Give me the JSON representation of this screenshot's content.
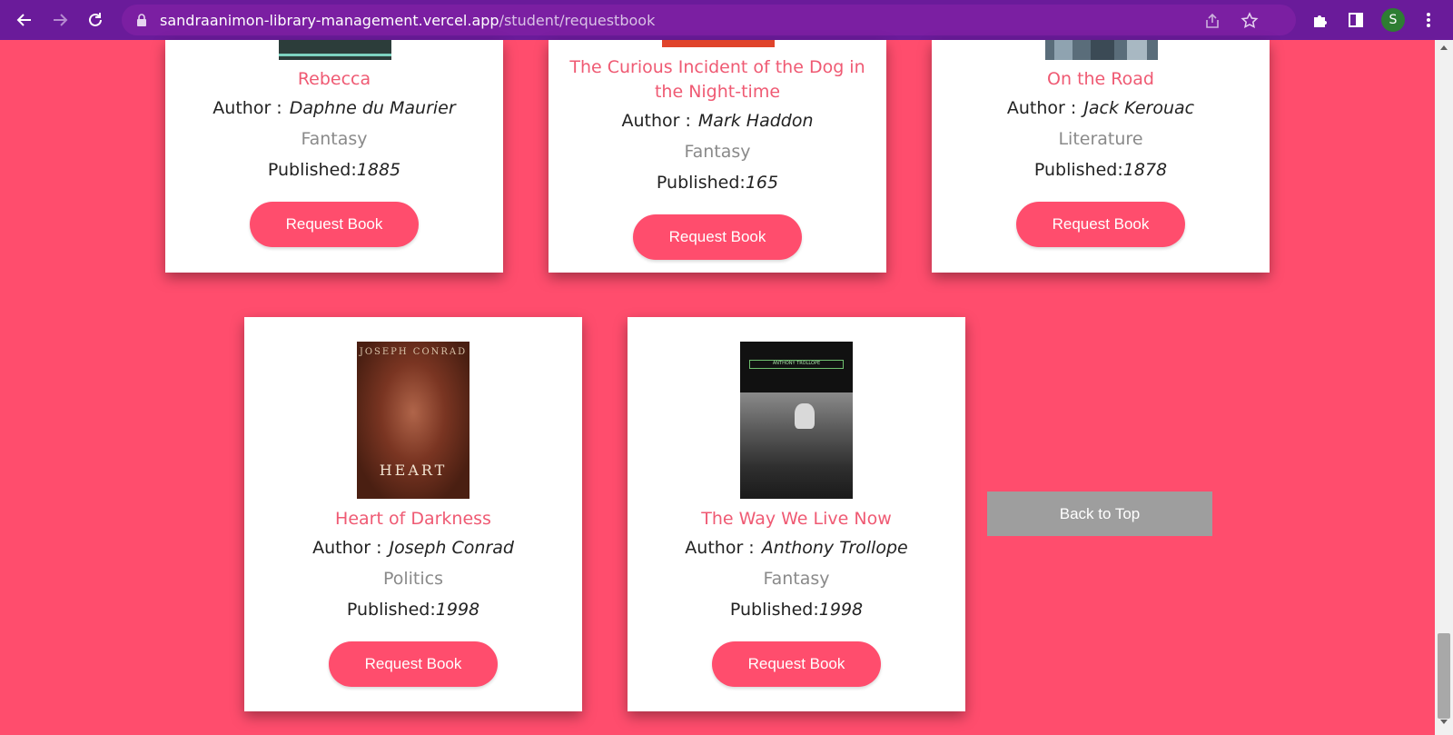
{
  "browser": {
    "url_domain": "sandraanimon-library-management.vercel.app",
    "url_path": "/student/requestbook",
    "avatar_letter": "S"
  },
  "books": [
    {
      "title": "Rebecca",
      "author_label": "Author :",
      "author": "Daphne du Maurier",
      "genre": "Fantasy",
      "published_label": "Published:",
      "year": "1885",
      "button": "Request Book"
    },
    {
      "title": "The Curious Incident of the Dog in the Night-time",
      "author_label": "Author :",
      "author": "Mark Haddon",
      "genre": "Fantasy",
      "published_label": "Published:",
      "year": "165",
      "button": "Request Book"
    },
    {
      "title": "On the Road",
      "author_label": "Author :",
      "author": "Jack Kerouac",
      "genre": "Literature",
      "published_label": "Published:",
      "year": "1878",
      "button": "Request Book"
    },
    {
      "title": "Heart of Darkness",
      "author_label": "Author :",
      "author": "Joseph Conrad",
      "genre": "Politics",
      "published_label": "Published:",
      "year": "1998",
      "button": "Request Book",
      "cover_text_top": "JOSEPH CONRAD",
      "cover_text_main": "HEART"
    },
    {
      "title": "The Way We Live Now",
      "author_label": "Author :",
      "author": "Anthony Trollope",
      "genre": "Fantasy",
      "published_label": "Published:",
      "year": "1998",
      "button": "Request Book",
      "cover_text_top": "ANTHONY TROLLOPE"
    }
  ],
  "back_to_top": "Back to Top",
  "colors": {
    "background": "#ff4d6d",
    "chrome": "#6a1b9a",
    "title": "#ef5a73",
    "back_button": "#9e9e9e"
  }
}
